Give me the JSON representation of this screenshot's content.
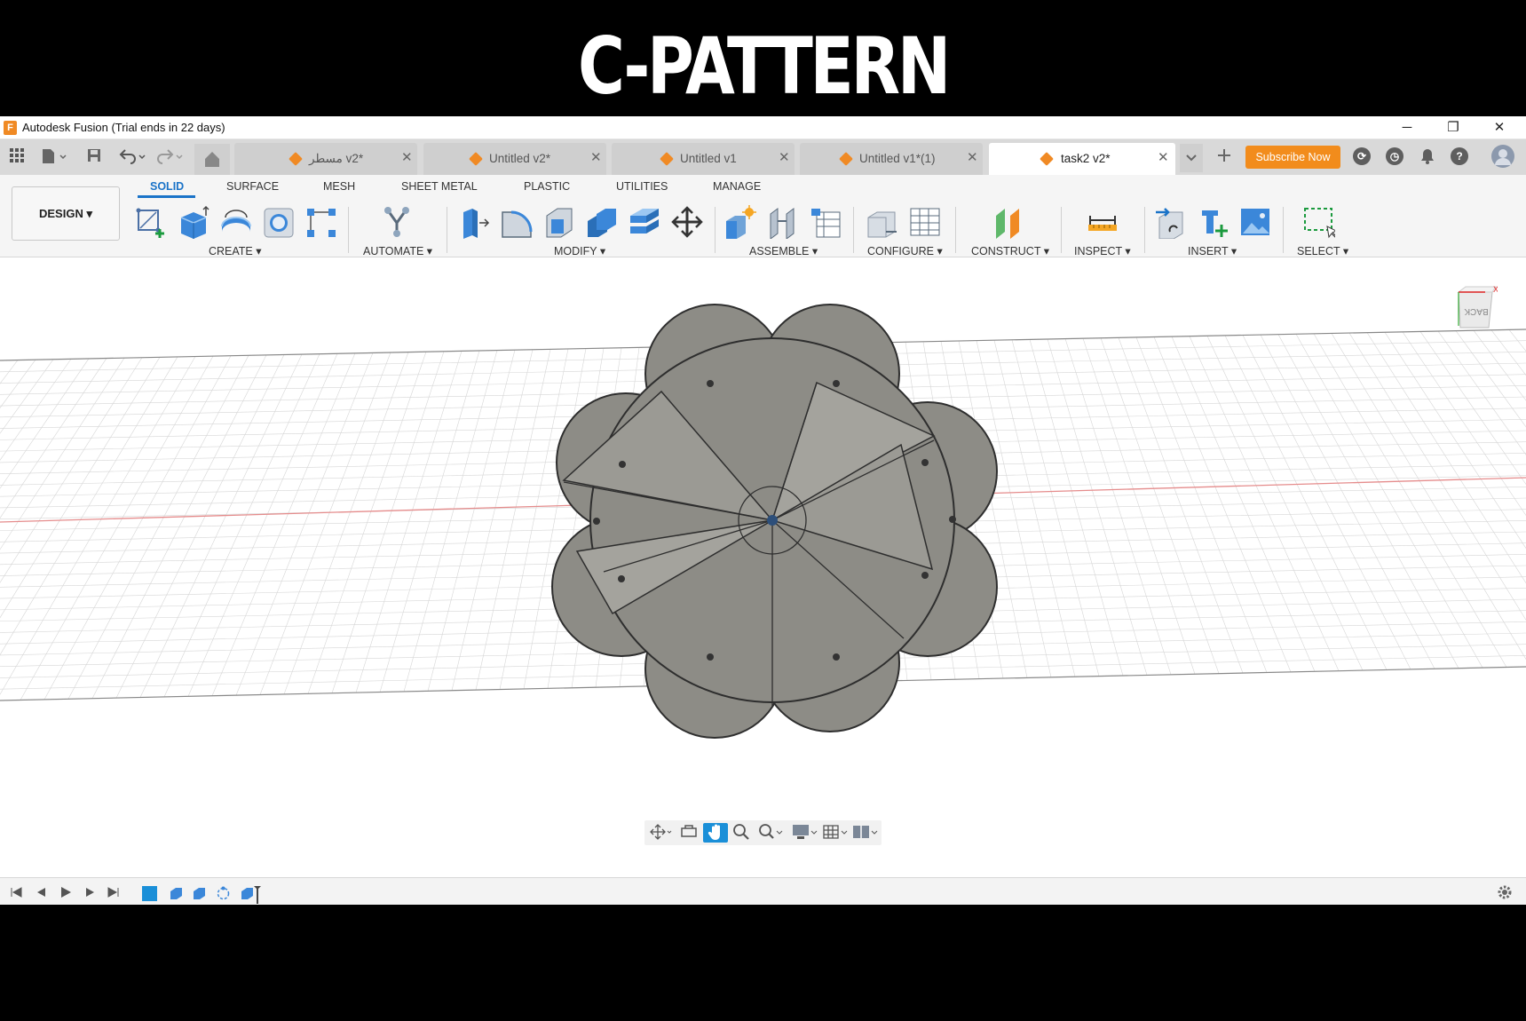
{
  "banner": {
    "title": "C-PATTERN"
  },
  "window": {
    "title": "Autodesk Fusion (Trial ends in 22 days)",
    "logo_letter": "F",
    "controls": {
      "minimize": "─",
      "restore": "❐",
      "close": "✕"
    }
  },
  "tabs": [
    {
      "label": "مسطر v2*",
      "active": false
    },
    {
      "label": "Untitled v2*",
      "active": false
    },
    {
      "label": "Untitled v1",
      "active": false
    },
    {
      "label": "Untitled v1*(1)",
      "active": false
    },
    {
      "label": "task2 v2*",
      "active": true
    }
  ],
  "tab_close": "✕",
  "header_right": {
    "subscribe_label": "Subscribe Now",
    "icons": [
      "sync-icon",
      "clock-icon",
      "bell-icon",
      "help-icon"
    ],
    "help_glyph": "?"
  },
  "workspace": {
    "label": "DESIGN ▾"
  },
  "ribbon_tabs": [
    {
      "label": "SOLID",
      "active": true
    },
    {
      "label": "SURFACE",
      "active": false
    },
    {
      "label": "MESH",
      "active": false
    },
    {
      "label": "SHEET METAL",
      "active": false
    },
    {
      "label": "PLASTIC",
      "active": false
    },
    {
      "label": "UTILITIES",
      "active": false
    },
    {
      "label": "MANAGE",
      "active": false
    }
  ],
  "groups": {
    "create": "CREATE ▾",
    "automate": "AUTOMATE ▾",
    "modify": "MODIFY ▾",
    "assemble": "ASSEMBLE ▾",
    "configure": "CONFIGURE ▾",
    "construct": "CONSTRUCT ▾",
    "inspect": "INSPECT ▾",
    "insert": "INSERT ▾",
    "select": "SELECT ▾"
  },
  "viewcube": {
    "face_label": "BACK",
    "axis_label": "X"
  },
  "colors": {
    "accent": "#1a73c8",
    "brand_orange": "#f08a24",
    "subscribe": "#f28c1c",
    "model_fill": "#8d8c86"
  }
}
